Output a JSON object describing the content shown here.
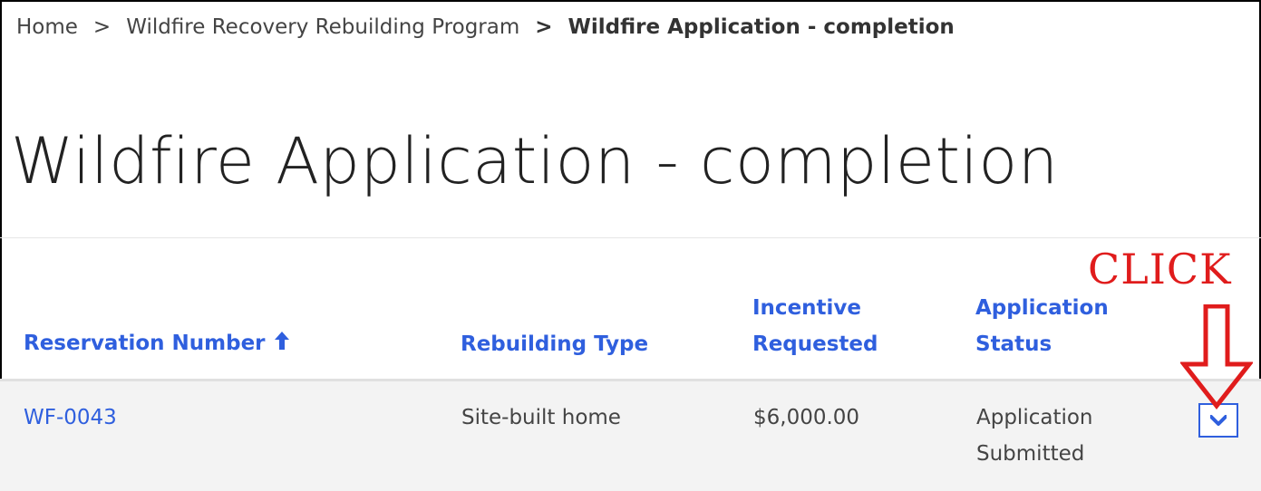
{
  "breadcrumb": {
    "home": "Home",
    "program": "Wildfire Recovery Rebuilding Program",
    "current": "Wildfire Application - completion",
    "separator": ">"
  },
  "page": {
    "title": "Wildfire Application - completion"
  },
  "table": {
    "headers": {
      "reservation_number": "Reservation Number",
      "rebuilding_type": "Rebuilding Type",
      "incentive_requested_line1": "Incentive",
      "incentive_requested_line2": "Requested",
      "application_status_line1": "Application",
      "application_status_line2": "Status"
    },
    "rows": [
      {
        "reservation_number": "WF-0043",
        "rebuilding_type": "Site-built home",
        "incentive_requested": "$6,000.00",
        "status_line1": "Application",
        "status_line2": "Submitted"
      }
    ]
  },
  "annotation": {
    "label": "CLICK",
    "color": "#e01c1c"
  },
  "icons": {
    "sort": "arrow-up-icon",
    "row_action": "chevron-down-icon"
  },
  "colors": {
    "link": "#2f5fde",
    "row_bg": "#f3f3f3"
  }
}
